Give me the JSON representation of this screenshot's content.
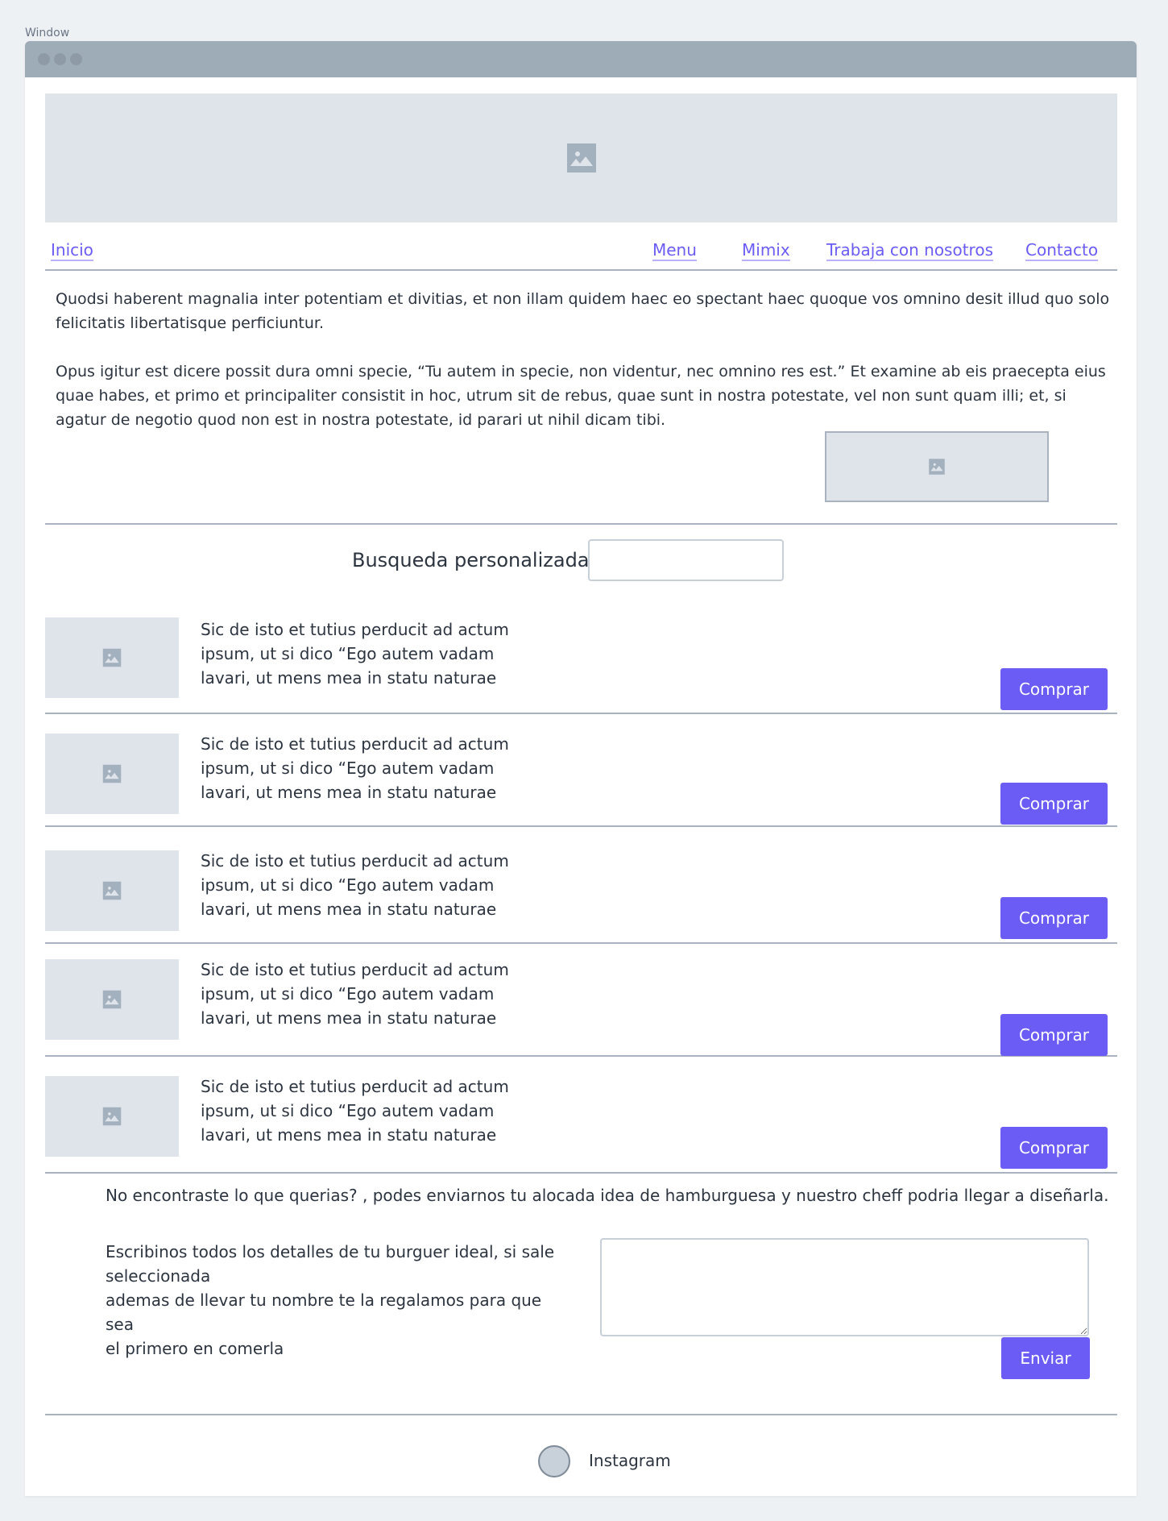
{
  "window": {
    "label": "Window"
  },
  "nav": {
    "home": "Inicio",
    "menu": "Menu",
    "mimix": "Mimix",
    "jobs": "Trabaja con nosotros",
    "contact": "Contacto"
  },
  "intro": {
    "paragraph1": "Quodsi haberent magnalia inter potentiam et divitias, et non illam quidem haec eo spectant haec quoque vos omnino desit illud quo solo felicitatis libertatisque perficiuntur.",
    "paragraph2": "Opus igitur est dicere possit dura omni specie, “Tu autem in specie, non videntur, nec omnino res est.” Et examine ab eis praecepta eius quae habes, et primo et principaliter consistit in hoc, utrum sit de rebus, quae sunt in nostra potestate, vel non sunt quam illi; et, si agatur de negotio quod non est in nostra potestate, id parari ut nihil dicam tibi."
  },
  "search": {
    "label": "Busqueda personalizada",
    "value": ""
  },
  "products": [
    {
      "line1": "Sic de isto et tutius perducit ad actum",
      "line2": "ipsum, ut si dico “Ego autem vadam",
      "line3": "lavari, ut mens mea in statu naturae",
      "button": "Comprar"
    },
    {
      "line1": "Sic de isto et tutius perducit ad actum",
      "line2": "ipsum, ut si dico “Ego autem vadam",
      "line3": "lavari, ut mens mea in statu naturae",
      "button": "Comprar"
    },
    {
      "line1": "Sic de isto et tutius perducit ad actum",
      "line2": "ipsum, ut si dico “Ego autem vadam",
      "line3": "lavari, ut mens mea in statu naturae",
      "button": "Comprar"
    },
    {
      "line1": "Sic de isto et tutius perducit ad actum",
      "line2": "ipsum, ut si dico “Ego autem vadam",
      "line3": "lavari, ut mens mea in statu naturae",
      "button": "Comprar"
    },
    {
      "line1": "Sic de isto et tutius perducit ad actum",
      "line2": "ipsum, ut si dico “Ego autem vadam",
      "line3": "lavari, ut mens mea in statu naturae",
      "button": "Comprar"
    }
  ],
  "custom": {
    "lead": "No encontraste lo que querias? , podes enviarnos tu alocada idea de hamburguesa y nuestro cheff podria llegar a diseñarla.",
    "detail1": "Escribinos todos los detalles de tu burguer ideal, si sale",
    "detail2": "seleccionada",
    "detail3": "ademas de llevar tu nombre te la regalamos para que sea",
    "detail4": "el primero en comerla",
    "send": "Enviar"
  },
  "social": {
    "instagram": "Instagram"
  },
  "colors": {
    "accent": "#6b5cf6",
    "placeholder": "#dfe4eb",
    "divider": "#a8b3bf"
  }
}
